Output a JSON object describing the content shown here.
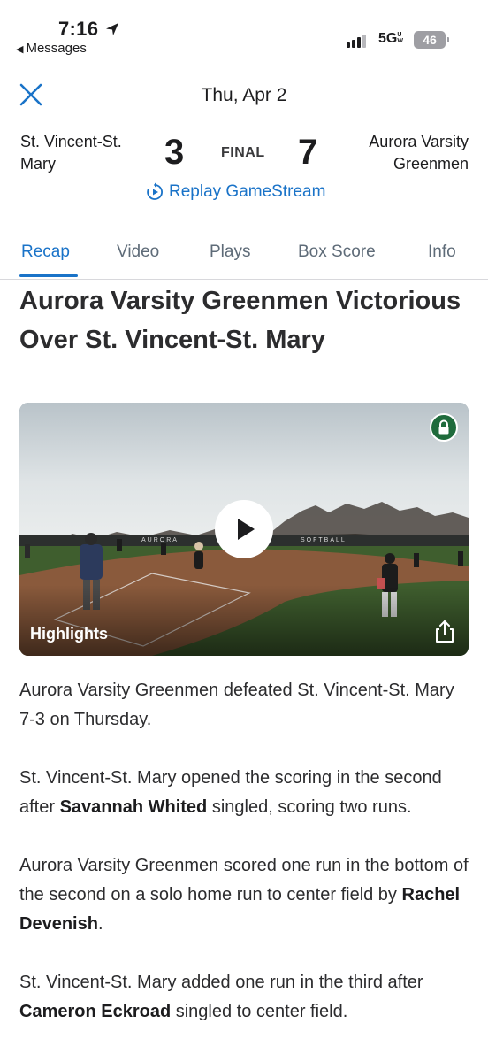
{
  "status_bar": {
    "time": "7:16",
    "back_app": "Messages",
    "network": "5G",
    "network_sup": "UW",
    "battery": "46"
  },
  "header": {
    "date": "Thu, Apr 2",
    "away_team": "St. Vincent-St. Mary",
    "away_score": "3",
    "status": "FINAL",
    "home_score": "7",
    "home_team": "Aurora Varsity Greenmen",
    "replay_label": "Replay GameStream"
  },
  "tabs": [
    {
      "label": "Recap",
      "active": true
    },
    {
      "label": "Video",
      "active": false
    },
    {
      "label": "Plays",
      "active": false
    },
    {
      "label": "Box Score",
      "active": false
    },
    {
      "label": "Info",
      "active": false
    }
  ],
  "article": {
    "headline": "Aurora Varsity Greenmen Victorious Over St. Vincent-St. Mary",
    "video": {
      "label": "Highlights",
      "fence_text_1": "AURORA",
      "fence_text_2": "SOFTBALL"
    },
    "paragraphs": [
      {
        "parts": [
          "Aurora Varsity Greenmen defeated St. Vincent-St. Mary 7-3 on Thursday."
        ]
      },
      {
        "before": "St. Vincent-St. Mary opened the scoring in the second after ",
        "bold": "Savannah Whited",
        "after": " singled, scoring two runs."
      },
      {
        "before": "Aurora Varsity Greenmen scored one run in the bottom of the second on a solo home run to center field by ",
        "bold": "Rachel Devenish",
        "after": "."
      },
      {
        "before": "St. Vincent-St. Mary added one run in the third after ",
        "bold": "Cameron Eckroad",
        "after": " singled to center field."
      }
    ]
  },
  "colors": {
    "accent": "#1a73c8",
    "lock_badge": "#1f6b3c",
    "text": "#2c2c2e"
  }
}
